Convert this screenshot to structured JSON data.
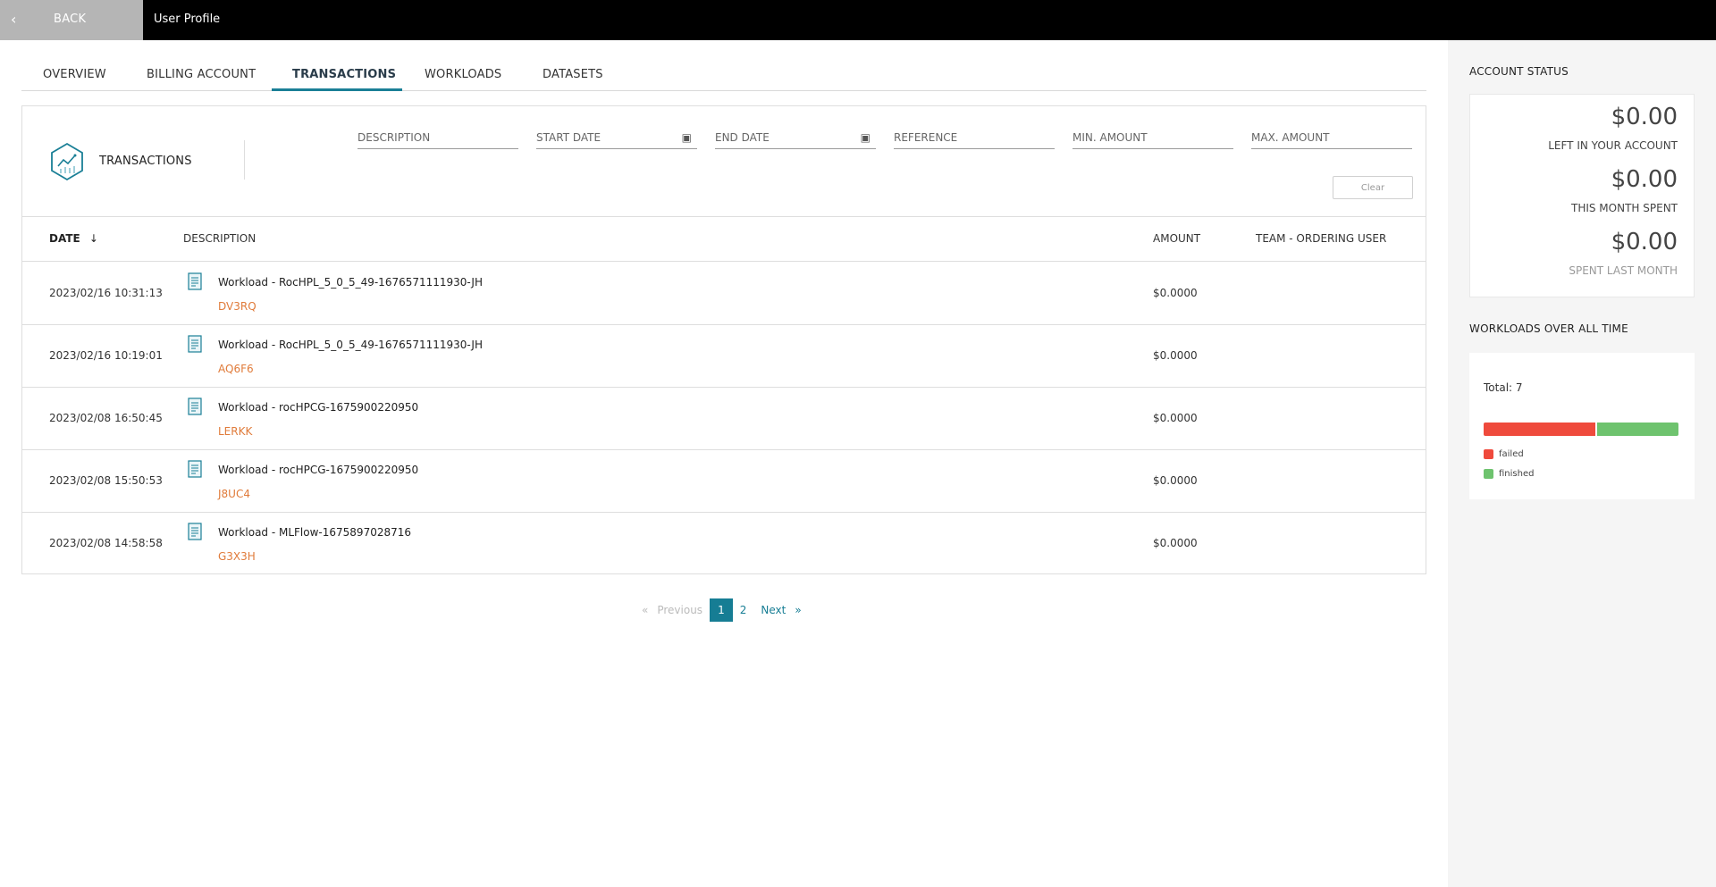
{
  "header": {
    "back_label": "BACK",
    "title": "User Profile"
  },
  "tabs": [
    {
      "label": "OVERVIEW",
      "active": false
    },
    {
      "label": "BILLING ACCOUNT",
      "active": false
    },
    {
      "label": "TRANSACTIONS",
      "active": true
    },
    {
      "label": "WORKLOADS",
      "active": false
    },
    {
      "label": "DATASETS",
      "active": false
    }
  ],
  "transactions": {
    "title": "TRANSACTIONS",
    "filters": {
      "description": "DESCRIPTION",
      "start_date": "START DATE",
      "end_date": "END DATE",
      "reference": "REFERENCE",
      "min_amount": "MIN. AMOUNT",
      "max_amount": "MAX. AMOUNT"
    },
    "clear_label": "Clear",
    "columns": {
      "date": "DATE",
      "description": "DESCRIPTION",
      "amount": "AMOUNT",
      "team": "TEAM - ORDERING USER"
    },
    "rows": [
      {
        "date": "2023/02/16 10:31:13",
        "description": "Workload - RocHPL_5_0_5_49-1676571111930-JH",
        "reference": "DV3RQ",
        "amount": "$0.0000",
        "team": ""
      },
      {
        "date": "2023/02/16 10:19:01",
        "description": "Workload - RocHPL_5_0_5_49-1676571111930-JH",
        "reference": "AQ6F6",
        "amount": "$0.0000",
        "team": ""
      },
      {
        "date": "2023/02/08 16:50:45",
        "description": "Workload - rocHPCG-1675900220950",
        "reference": "LERKK",
        "amount": "$0.0000",
        "team": ""
      },
      {
        "date": "2023/02/08 15:50:53",
        "description": "Workload - rocHPCG-1675900220950",
        "reference": "J8UC4",
        "amount": "$0.0000",
        "team": ""
      },
      {
        "date": "2023/02/08 14:58:58",
        "description": "Workload - MLFlow-1675897028716",
        "reference": "G3X3H",
        "amount": "$0.0000",
        "team": ""
      }
    ]
  },
  "pagination": {
    "prev_arrow": "«",
    "previous": "Previous",
    "pages": [
      "1",
      "2"
    ],
    "current": "1",
    "next": "Next",
    "next_arrow": "»"
  },
  "account_status": {
    "heading": "ACCOUNT STATUS",
    "left_value": "$0.00",
    "left_label": "LEFT IN YOUR ACCOUNT",
    "month_value": "$0.00",
    "month_label": "THIS MONTH SPENT",
    "last_value": "$0.00",
    "last_label": "SPENT LAST MONTH"
  },
  "workloads": {
    "heading": "WORKLOADS OVER ALL TIME",
    "total_label": "Total: 7",
    "segments": [
      {
        "name": "failed",
        "count": 4,
        "color": "#ef4a3c"
      },
      {
        "name": "finished",
        "count": 3,
        "color": "#6ec36e"
      }
    ]
  },
  "colors": {
    "accent": "#167d94",
    "reference": "#e07b3a"
  }
}
